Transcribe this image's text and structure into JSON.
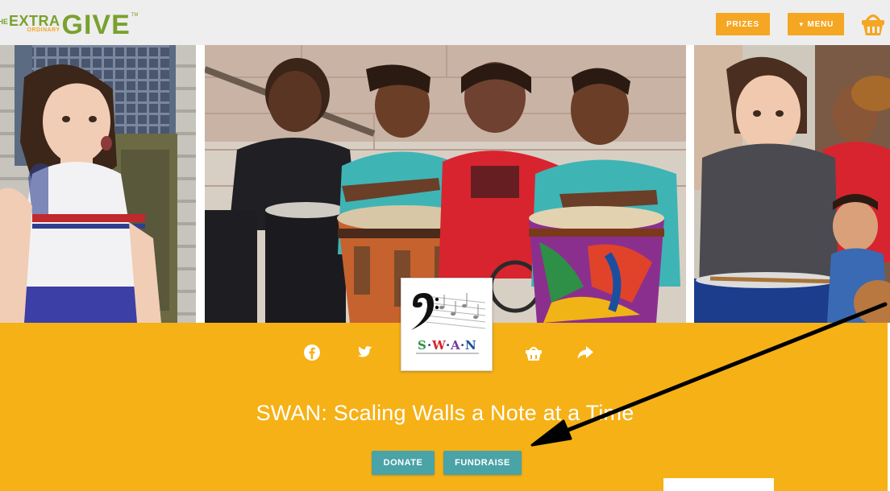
{
  "header": {
    "logo": {
      "the": "THE",
      "extra": "EXTRA",
      "ordinary": "ORDINARY",
      "give": "GIVE",
      "tm": "TM"
    },
    "prizes_label": "PRIZES",
    "menu_label": "MENU",
    "menu_icon": "triangle-down-icon",
    "basket_icon": "basket-icon"
  },
  "photos": [
    {
      "description_name": "photo-girl-singing"
    },
    {
      "description_name": "photo-kids-drumming"
    },
    {
      "description_name": "photo-boy-drumming"
    }
  ],
  "social": {
    "icons": [
      "facebook-icon",
      "twitter-icon",
      "basket-icon",
      "share-icon"
    ]
  },
  "org": {
    "logo_text": "S·W·A·N",
    "title": "SWAN: Scaling Walls a Note at a Time"
  },
  "actions": {
    "donate_label": "DONATE",
    "fundraise_label": "FUNDRAISE"
  },
  "colors": {
    "brand_orange": "#f5b116",
    "button_orange": "#f5a623",
    "teal": "#4aa3a6",
    "logo_green": "#7aa12f"
  }
}
